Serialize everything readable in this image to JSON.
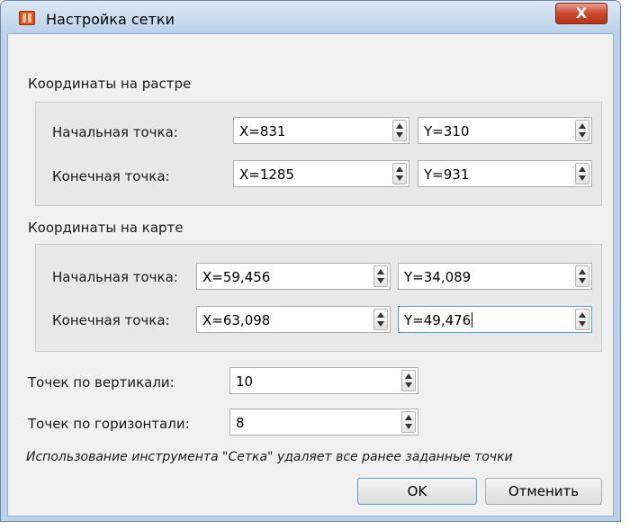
{
  "window": {
    "title": "Настройка сетки",
    "close_glyph": "X",
    "app_icon": "map-grid-app-icon"
  },
  "raster": {
    "label": "Координаты на растре",
    "start_label": "Начальная точка:",
    "end_label": "Конечная точка:",
    "start_x": "X=831",
    "start_y": "Y=310",
    "end_x": "X=1285",
    "end_y": "Y=931"
  },
  "map": {
    "label": "Координаты на карте",
    "start_label": "Начальная точка:",
    "end_label": "Конечная точка:",
    "start_x": "X=59,456",
    "start_y": "Y=34,089",
    "end_x": "X=63,098",
    "end_y": "Y=49,476"
  },
  "grid": {
    "vertical_label": "Точек по вертикали:",
    "vertical_value": "10",
    "horizontal_label": "Точек по горизонтали:",
    "horizontal_value": "8"
  },
  "note": "Использование инструмента \"Сетка\" удаляет все ранее заданные точки",
  "buttons": {
    "ok": "OK",
    "cancel": "Отменить"
  },
  "colors": {
    "accent_focus": "#569de5",
    "close_button": "#c9482d"
  }
}
